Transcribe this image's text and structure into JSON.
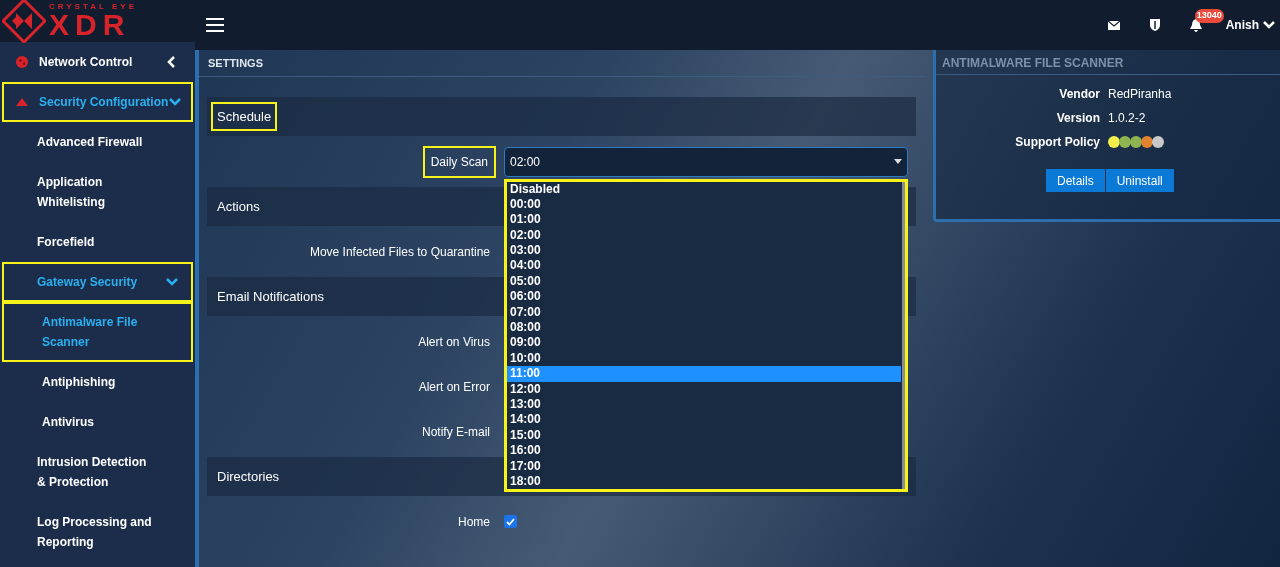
{
  "header": {
    "logo_top": "CRYSTAL EYE",
    "logo_main": "XDR",
    "notification_count": "13040",
    "user": "Anish"
  },
  "sidebar": {
    "items": [
      {
        "label": "Network Control",
        "selected": false,
        "highlighted": false,
        "expanded": false
      },
      {
        "label": "Security Configuration",
        "selected": true,
        "highlighted": true,
        "expanded": true,
        "children": [
          {
            "label": "Advanced Firewall",
            "selected": false,
            "highlighted": false
          },
          {
            "label": "Application Whitelisting",
            "selected": false,
            "highlighted": false
          },
          {
            "label": "Forcefield",
            "selected": false,
            "highlighted": false
          },
          {
            "label": "Gateway Security",
            "selected": true,
            "highlighted": true,
            "expanded": true,
            "children": [
              {
                "label": "Antimalware File Scanner",
                "selected": true,
                "highlighted": true
              },
              {
                "label": "Antiphishing",
                "selected": false,
                "highlighted": false
              },
              {
                "label": "Antivirus",
                "selected": false,
                "highlighted": false
              }
            ]
          },
          {
            "label": "Intrusion Detection & Protection",
            "selected": false,
            "highlighted": false
          },
          {
            "label": "Log Processing and Reporting",
            "selected": false,
            "highlighted": false
          }
        ]
      }
    ]
  },
  "settings": {
    "heading": "SETTINGS",
    "sections": [
      {
        "title": "Schedule",
        "highlighted": true,
        "rows": [
          {
            "label": "Daily Scan",
            "kind": "select",
            "highlighted": true,
            "value": "02:00",
            "dropdown": {
              "highlighted": true,
              "options": [
                {
                  "label": "Disabled",
                  "selected": false
                },
                {
                  "label": "00:00",
                  "selected": false
                },
                {
                  "label": "01:00",
                  "selected": false
                },
                {
                  "label": "02:00",
                  "selected": false
                },
                {
                  "label": "03:00",
                  "selected": false
                },
                {
                  "label": "04:00",
                  "selected": false
                },
                {
                  "label": "05:00",
                  "selected": false
                },
                {
                  "label": "06:00",
                  "selected": false
                },
                {
                  "label": "07:00",
                  "selected": false
                },
                {
                  "label": "08:00",
                  "selected": false
                },
                {
                  "label": "09:00",
                  "selected": false
                },
                {
                  "label": "10:00",
                  "selected": false
                },
                {
                  "label": "11:00",
                  "selected": true
                },
                {
                  "label": "12:00",
                  "selected": false
                },
                {
                  "label": "13:00",
                  "selected": false
                },
                {
                  "label": "14:00",
                  "selected": false
                },
                {
                  "label": "15:00",
                  "selected": false
                },
                {
                  "label": "16:00",
                  "selected": false
                },
                {
                  "label": "17:00",
                  "selected": false
                },
                {
                  "label": "18:00",
                  "selected": false
                }
              ]
            }
          }
        ]
      },
      {
        "title": "Actions",
        "highlighted": false,
        "rows": [
          {
            "label": "Move Infected Files to Quarantine",
            "kind": "text",
            "highlighted": false
          }
        ]
      },
      {
        "title": "Email Notifications",
        "highlighted": false,
        "rows": [
          {
            "label": "Alert on Virus",
            "kind": "text",
            "highlighted": false
          },
          {
            "label": "Alert on Error",
            "kind": "text",
            "highlighted": false
          },
          {
            "label": "Notify E-mail",
            "kind": "text",
            "highlighted": false
          }
        ]
      },
      {
        "title": "Directories",
        "highlighted": false,
        "rows": [
          {
            "label": "Home",
            "kind": "checkbox",
            "highlighted": false,
            "checked": true
          }
        ]
      }
    ]
  },
  "scanner_panel": {
    "title": "ANTIMALWARE FILE SCANNER",
    "fields": [
      {
        "label": "Vendor",
        "kind": "text",
        "value": "RedPiranha"
      },
      {
        "label": "Version",
        "kind": "text",
        "value": "1.0.2-2"
      },
      {
        "label": "Support Policy",
        "kind": "dots",
        "dots": [
          {
            "color": "#f2ef4c"
          },
          {
            "color": "#8fb452"
          },
          {
            "color": "#8fb452"
          },
          {
            "color": "#e0822f"
          },
          {
            "color": "#c9c9c9"
          }
        ]
      }
    ],
    "buttons": [
      "Details",
      "Uninstall"
    ]
  }
}
